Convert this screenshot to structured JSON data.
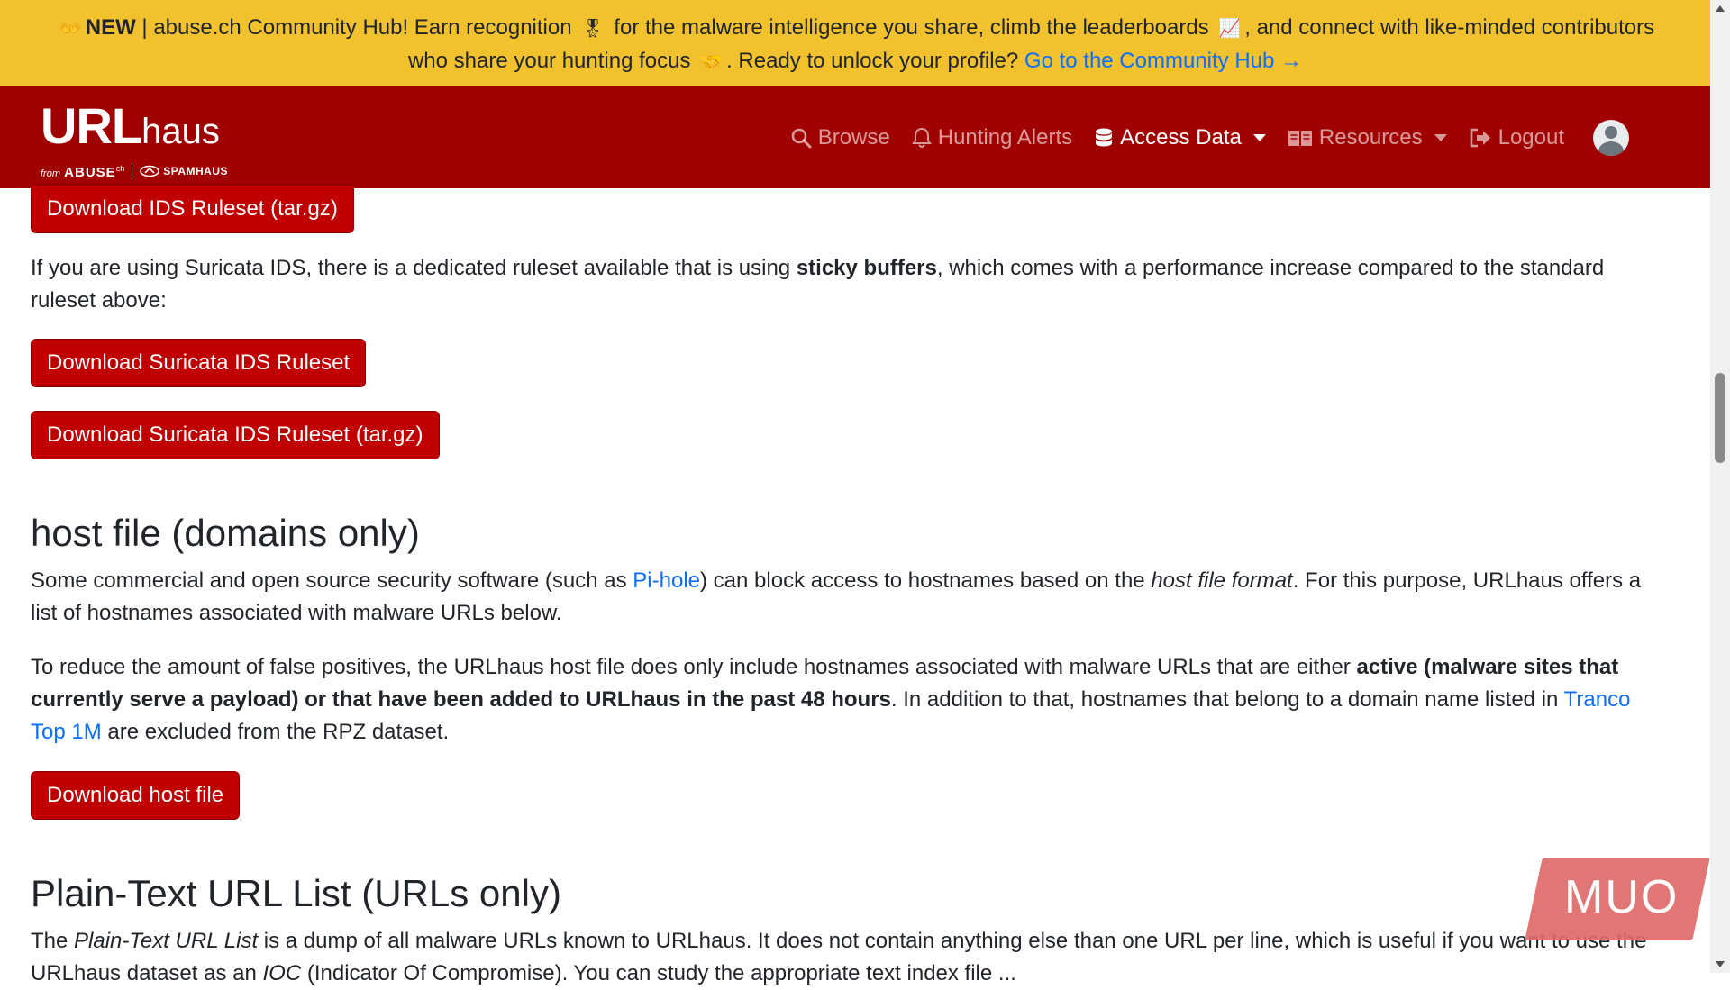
{
  "banner": {
    "emoji_1": "👐",
    "new_label": "NEW",
    "line1_a": " | abuse.ch Community Hub! Earn recognition ",
    "emoji_2": "🎖",
    "line1_b": " for the malware intelligence you share, climb the leaderboards ",
    "emoji_3": "📈",
    "line1_c": ", and connect with like-minded contributors",
    "line2_a": "who share your hunting focus ",
    "emoji_4": "🤝",
    "line2_b": ". Ready to unlock your profile? ",
    "link": "Go to the Community Hub →"
  },
  "navbar": {
    "brand": {
      "url": "URL",
      "haus": "haus",
      "from": "from",
      "abuse": "ABUSE",
      "ch": "ch",
      "spamhaus": "SPAMHAUS"
    },
    "items": [
      {
        "label": "Browse",
        "icon": "search-icon"
      },
      {
        "label": "Hunting Alerts",
        "icon": "bell-icon"
      },
      {
        "label": "Access Data",
        "icon": "database-icon",
        "active": true
      },
      {
        "label": "Resources",
        "icon": "book-icon"
      },
      {
        "label": "Logout",
        "icon": "logout-icon"
      }
    ],
    "avatar_icon": "user-avatar-icon"
  },
  "content": {
    "btn_ids_targz": "Download IDS Ruleset (tar.gz)",
    "suricata_p_a": "If you are using Suricata IDS, there is a dedicated ruleset available that is using ",
    "suricata_p_bold": "sticky buffers",
    "suricata_p_b": ", which comes with a performance increase compared to the standard ruleset above:",
    "btn_suricata": "Download Suricata IDS Ruleset",
    "btn_suricata_targz": "Download Suricata IDS Ruleset (tar.gz)",
    "host_heading": "host file (domains only)",
    "host_p1_a": "Some commercial and open source security software (such as ",
    "host_p1_link": "Pi-hole",
    "host_p1_b": ") can block access to hostnames based on the ",
    "host_p1_em": "host file format",
    "host_p1_c": ". For this purpose, URLhaus offers a list of hostnames associated with malware URLs below.",
    "host_p2_a": "To reduce the amount of false positives, the URLhaus host file does only include hostnames associated with malware URLs that are either ",
    "host_p2_bold": "active (malware sites that currently serve a payload) or that have been added to URLhaus in the past 48 hours",
    "host_p2_b": ". In addition to that, hostnames that belong to a domain name listed in ",
    "host_p2_link": "Tranco Top 1M",
    "host_p2_c": " are excluded from the RPZ dataset.",
    "btn_host": "Download host file",
    "plain_heading": "Plain-Text URL List (URLs only)",
    "plain_p_a": "The ",
    "plain_p_em": "Plain-Text URL List",
    "plain_p_b": " is a dump of all malware URLs known to URLhaus. It does not contain anything else than one URL per line, which is useful if you want to use the URLhaus dataset as an ",
    "plain_p_em2": "IOC",
    "plain_p_c": " (Indicator Of Compromise). You can study the appropriate text index file ..."
  },
  "watermark": "MUO"
}
